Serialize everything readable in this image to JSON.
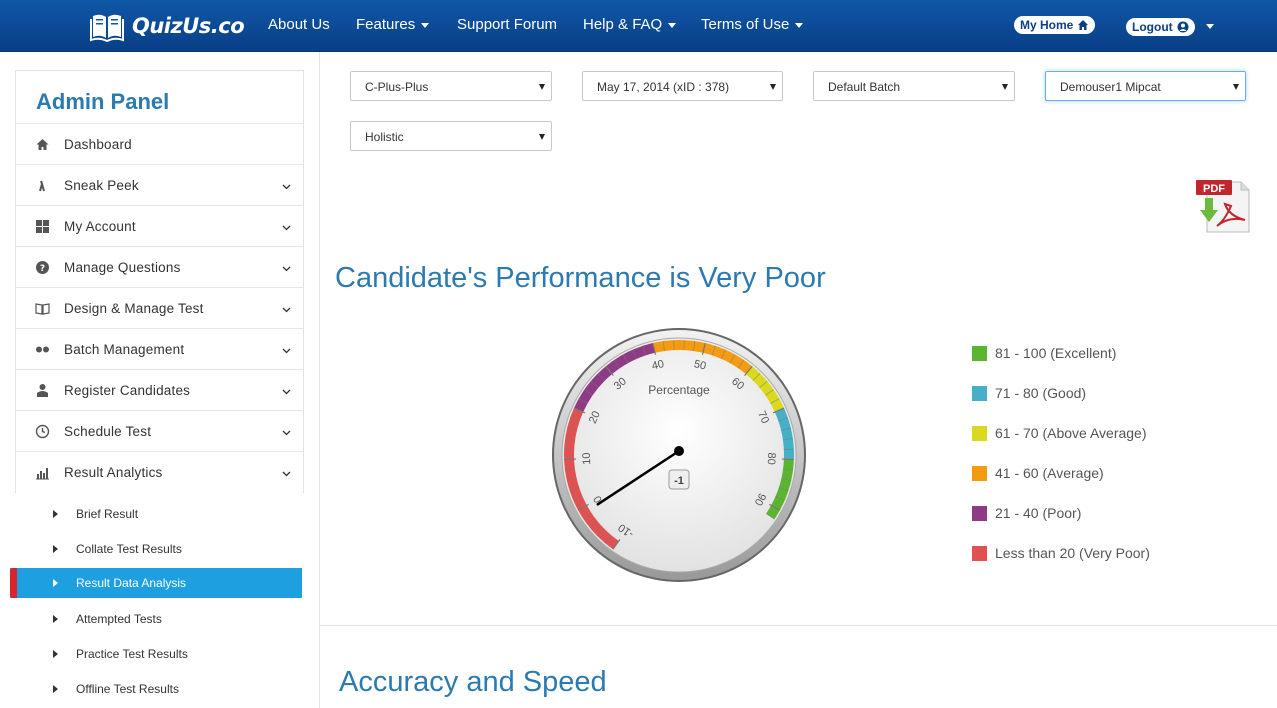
{
  "header": {
    "brand": "QuizUs.co",
    "nav": [
      "About Us",
      "Features",
      "Support Forum",
      "Help & FAQ",
      "Terms of Use"
    ],
    "my_home": "My Home",
    "logout": "Logout"
  },
  "sidebar": {
    "title": "Admin Panel",
    "items": [
      {
        "label": "Dashboard",
        "icon": "home-icon"
      },
      {
        "label": "Sneak Peek",
        "icon": "sneak-peek-icon"
      },
      {
        "label": "My Account",
        "icon": "grid-icon"
      },
      {
        "label": "Manage Questions",
        "icon": "question-circle-icon"
      },
      {
        "label": "Design & Manage Test",
        "icon": "book-open-icon"
      },
      {
        "label": "Batch Management",
        "icon": "dots-icon"
      },
      {
        "label": "Register Candidates",
        "icon": "user-icon"
      },
      {
        "label": "Schedule Test",
        "icon": "clock-icon"
      },
      {
        "label": "Result Analytics",
        "icon": "bar-chart-icon"
      }
    ],
    "sub_items": [
      "Brief Result",
      "Collate Test Results",
      "Result Data Analysis",
      "Attempted Tests",
      "Practice Test Results",
      "Offline Test Results"
    ],
    "active_sub": "Result Data Analysis"
  },
  "filters": {
    "subject": "C-Plus-Plus",
    "date": "May 17, 2014 (xID : 378)",
    "batch": "Default Batch",
    "candidate": "Demouser1 Mipcat",
    "view": "Holistic"
  },
  "pdf_label": "PDF",
  "performance_title": "Candidate's Performance is Very Poor",
  "gauge": {
    "title": "Percentage",
    "value": -1,
    "value_label": "-1",
    "min": -10,
    "max": 100,
    "ticks": [
      "-10",
      "0",
      "10",
      "20",
      "30",
      "40",
      "50",
      "60",
      "70",
      "80",
      "90"
    ]
  },
  "legend": [
    {
      "label": "81 - 100 (Excellent)",
      "color": "#5cb531"
    },
    {
      "label": "71 - 80 (Good)",
      "color": "#45b0c7"
    },
    {
      "label": "61 - 70 (Above Average)",
      "color": "#d9d91f"
    },
    {
      "label": "41 - 60 (Average)",
      "color": "#f39c12"
    },
    {
      "label": "21 - 40 (Poor)",
      "color": "#8e3a85"
    },
    {
      "label": "Less than 20 (Very Poor)",
      "color": "#e05252"
    }
  ],
  "accuracy_title": "Accuracy and Speed"
}
